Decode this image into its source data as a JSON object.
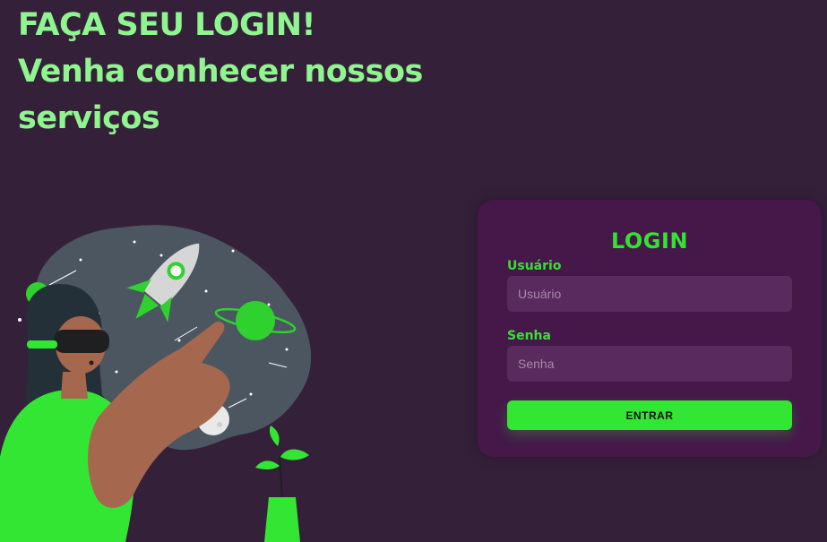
{
  "hero": {
    "line1": "FAÇA SEU LOGIN!",
    "line2": "Venha conhecer nossos",
    "line3": "serviços"
  },
  "login": {
    "title": "LOGIN",
    "username": {
      "label": "Usuário",
      "placeholder": "Usuário",
      "value": ""
    },
    "password": {
      "label": "Senha",
      "placeholder": "Senha",
      "value": ""
    },
    "submit_label": "ENTRAR"
  },
  "colors": {
    "background": "#35203a",
    "card": "#451849",
    "accent": "#34e233",
    "headline": "#8ff58f",
    "input_bg": "#582a5e"
  },
  "illustration": {
    "icon": "vr-space-woman-illustration"
  }
}
